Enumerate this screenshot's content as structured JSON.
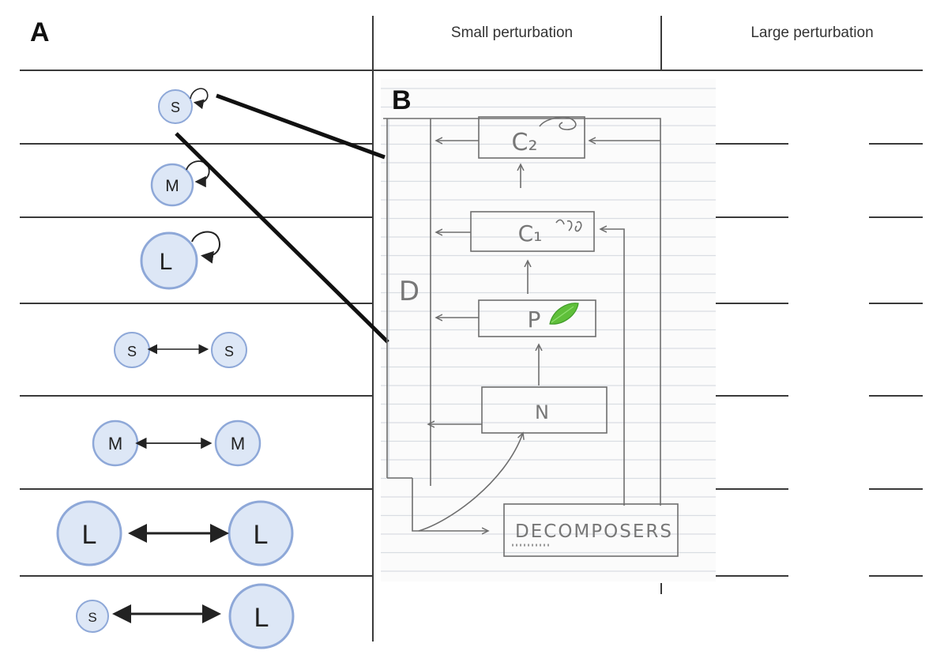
{
  "panel_a": {
    "label": "A",
    "columns": [
      "Small perturbation",
      "Large perturbation"
    ],
    "rows": [
      {
        "kind": "self",
        "nodes": [
          "S"
        ],
        "sizes": [
          "small"
        ]
      },
      {
        "kind": "self",
        "nodes": [
          "M"
        ],
        "sizes": [
          "medium"
        ]
      },
      {
        "kind": "self",
        "nodes": [
          "L"
        ],
        "sizes": [
          "large"
        ]
      },
      {
        "kind": "pair",
        "nodes": [
          "S",
          "S"
        ],
        "sizes": [
          "small",
          "small"
        ]
      },
      {
        "kind": "pair",
        "nodes": [
          "M",
          "M"
        ],
        "sizes": [
          "medium",
          "medium"
        ]
      },
      {
        "kind": "pair",
        "nodes": [
          "L",
          "L"
        ],
        "sizes": [
          "large",
          "large"
        ]
      },
      {
        "kind": "pair",
        "nodes": [
          "S",
          "L"
        ],
        "sizes": [
          "small",
          "large"
        ]
      }
    ],
    "colors": {
      "node_fill": "#dde7f6",
      "node_stroke": "#8ea8d8",
      "grid": "#3a3a3a"
    }
  },
  "panel_b": {
    "label": "B",
    "boxes": {
      "c2": "C₂",
      "c1": "C₁",
      "p": "P",
      "n": "N",
      "decomposers": "DECOMPOSERS"
    },
    "side_label": "D",
    "icons": [
      "cat-doodle-icon",
      "beetle-doodle-icon",
      "leaf-icon"
    ],
    "colors": {
      "paper": "#fbfbfb",
      "rule_line": "#d9dde3",
      "pen": "#6e6e6e",
      "leaf": "#5fbf3a"
    }
  }
}
